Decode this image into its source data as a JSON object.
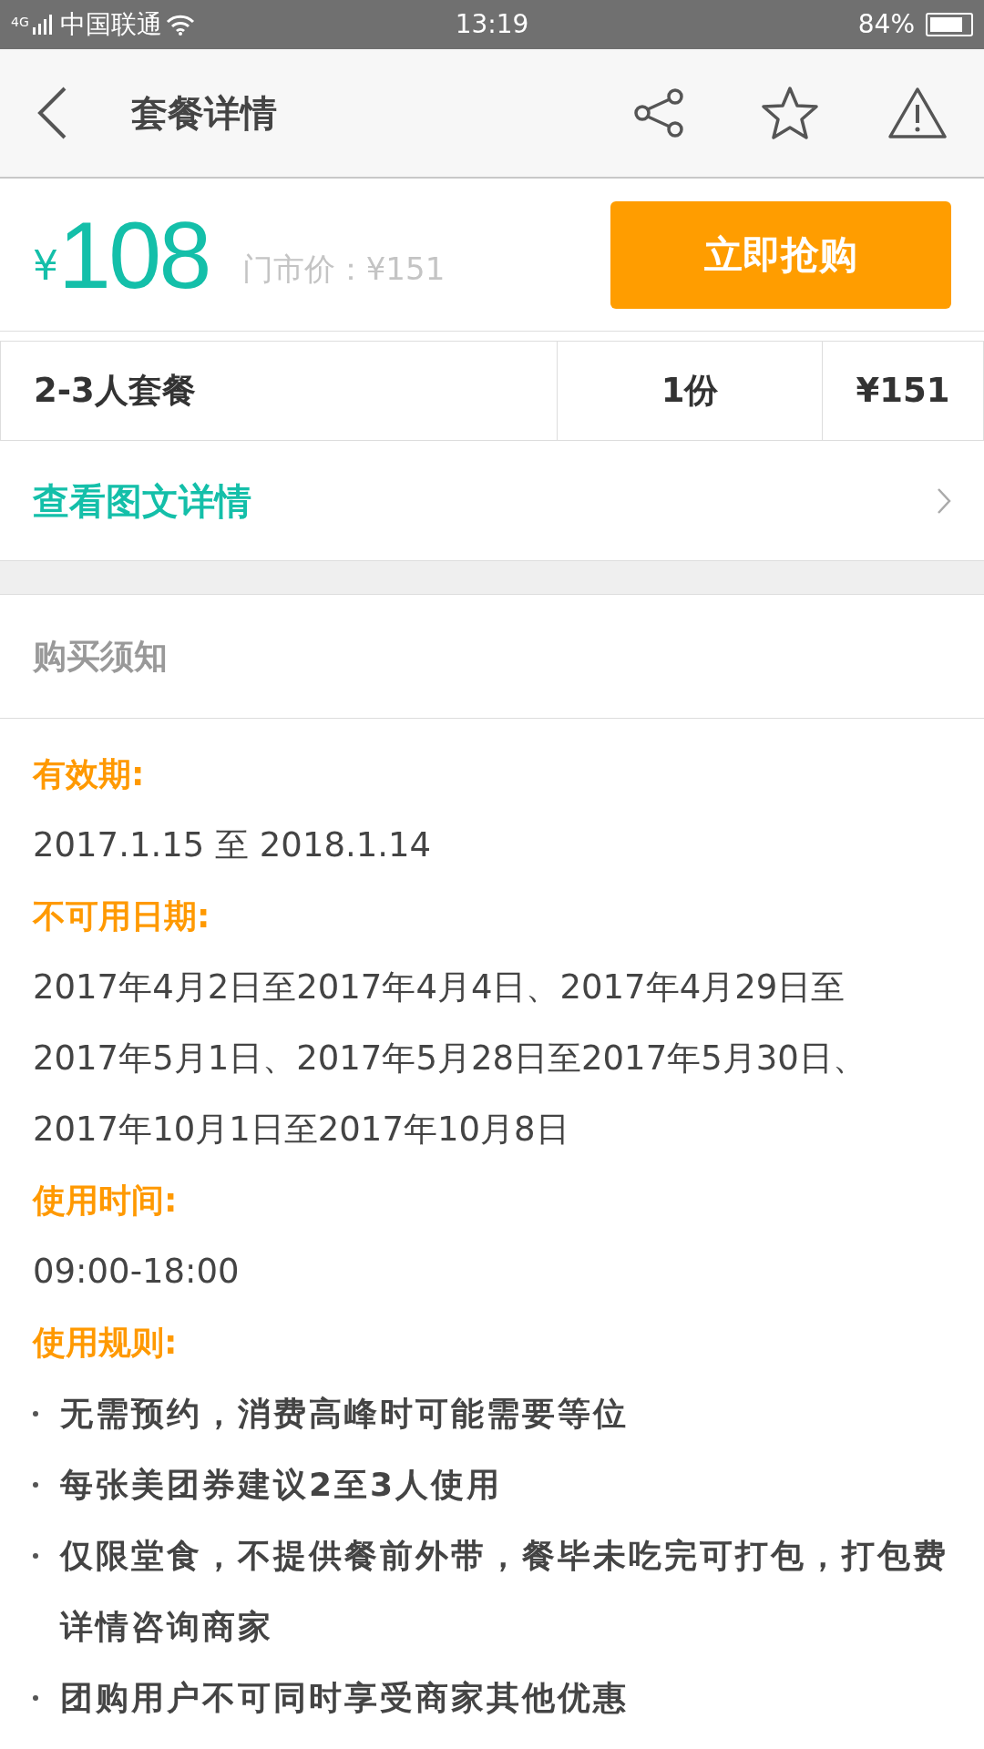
{
  "status_bar": {
    "network": "4G",
    "carrier": "中国联通",
    "time": "13:19",
    "battery": "84%"
  },
  "header": {
    "title": "套餐详情"
  },
  "price": {
    "currency": "¥",
    "amount": "108",
    "original_price": "门市价：¥151",
    "buy_button": "立即抢购"
  },
  "package_table": [
    {
      "name": "2-3人套餐",
      "quantity": "1份",
      "price": "¥151"
    }
  ],
  "details_link": "查看图文详情",
  "notice": {
    "title": "购买须知",
    "sections": [
      {
        "heading": "有效期:",
        "kind": "text",
        "items": [
          "2017.1.15 至 2018.1.14"
        ]
      },
      {
        "heading": "不可用日期:",
        "kind": "text",
        "items": [
          "2017年4月2日至2017年4月4日、2017年4月29日至2017年5月1日、2017年5月28日至2017年5月30日、2017年10月1日至2017年10月8日"
        ]
      },
      {
        "heading": "使用时间:",
        "kind": "text",
        "items": [
          "09:00-18:00"
        ]
      },
      {
        "heading": "使用规则:",
        "kind": "bullets",
        "items": [
          "无需预约，消费高峰时可能需要等位",
          "每张美团券建议2至3人使用",
          "仅限堂食，不提供餐前外带，餐毕未吃完可打包，打包费详情咨询商家",
          "团购用户不可同时享受商家其他优惠"
        ]
      }
    ]
  }
}
